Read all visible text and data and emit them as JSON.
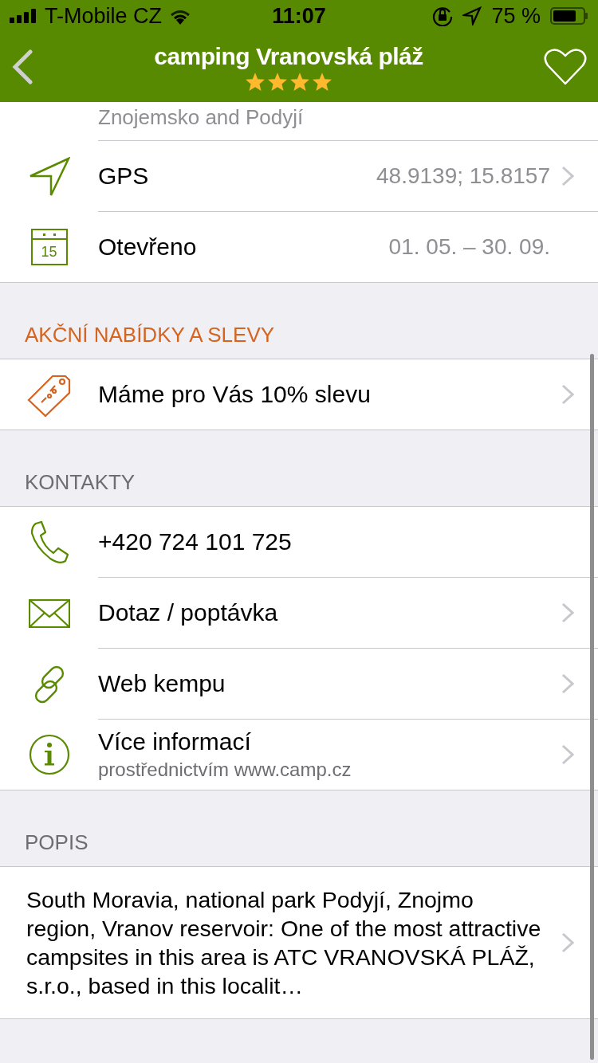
{
  "status_bar": {
    "carrier": "T-Mobile CZ",
    "time": "11:07",
    "battery": "75 %"
  },
  "header": {
    "title": "camping Vranovská pláž",
    "stars": 4
  },
  "top_row": {
    "subtitle": "Znojemsko and Podyjí"
  },
  "info_rows": [
    {
      "kind": "gps",
      "label": "GPS",
      "value": "48.9139; 15.8157",
      "disclosure": true
    },
    {
      "kind": "calendar",
      "icon_text": "15",
      "label": "Otevřeno",
      "value": "01. 05. – 30. 09.",
      "disclosure": false
    }
  ],
  "sections": [
    {
      "title": "AKČNÍ NABÍDKY A SLEVY",
      "accent": true,
      "rows": [
        {
          "kind": "tag",
          "label": "Máme pro Vás 10% slevu",
          "disclosure": true
        }
      ]
    },
    {
      "title": "KONTAKTY",
      "accent": false,
      "rows": [
        {
          "kind": "phone",
          "label": "+420 724 101 725",
          "disclosure": false
        },
        {
          "kind": "mail",
          "label": "Dotaz / poptávka",
          "disclosure": true
        },
        {
          "kind": "link",
          "label": "Web kempu",
          "disclosure": true
        },
        {
          "kind": "info",
          "label": "Více informací",
          "subtitle": "prostřednictvím www.camp.cz",
          "disclosure": true
        }
      ]
    },
    {
      "title": "POPIS",
      "accent": false,
      "rows": [
        {
          "kind": "text",
          "label": "South Moravia, national park Podyjí, Znojmo region, Vranov reservoir: One of the most attractive campsites in this area is ATC VRANOVSKÁ PLÁŽ, s.r.o., based in this localit…",
          "disclosure": true
        }
      ]
    }
  ]
}
